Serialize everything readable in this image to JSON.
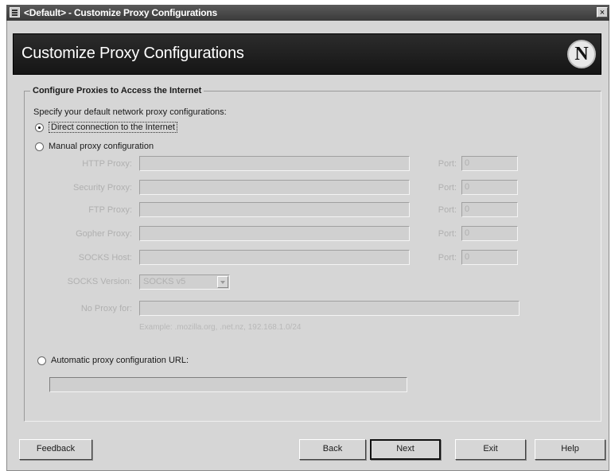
{
  "window": {
    "title": "<Default> - Customize Proxy Configurations",
    "close_glyph": "×"
  },
  "banner": {
    "heading": "Customize Proxy Configurations",
    "logo_letter": "N",
    "logo_icon": "netscape-n-icon"
  },
  "group": {
    "title": "Configure Proxies to Access the Internet",
    "description": "Specify your default network proxy configurations:",
    "direct_label": "Direct connection to the Internet",
    "direct_selected": true,
    "manual_label": "Manual proxy configuration",
    "manual_selected": false,
    "proxies": [
      {
        "label": "HTTP Proxy:",
        "port_label": "Port:",
        "port_value": "0"
      },
      {
        "label": "Security Proxy:",
        "port_label": "Port:",
        "port_value": "0"
      },
      {
        "label": "FTP Proxy:",
        "port_label": "Port:",
        "port_value": "0"
      },
      {
        "label": "Gopher Proxy:",
        "port_label": "Port:",
        "port_value": "0"
      },
      {
        "label": "SOCKS Host:",
        "port_label": "Port:",
        "port_value": "0"
      }
    ],
    "socks_version_label": "SOCKS Version:",
    "socks_version_value": "SOCKS v5",
    "no_proxy_label": "No Proxy for:",
    "no_proxy_hint": "Example: .mozilla.org, .net.nz, 192.168.1.0/24",
    "auto_label": "Automatic proxy configuration URL:",
    "auto_selected": false,
    "auto_url_value": ""
  },
  "buttons": {
    "feedback": "Feedback",
    "back": "Back",
    "next": "Next",
    "exit": "Exit",
    "help": "Help"
  }
}
